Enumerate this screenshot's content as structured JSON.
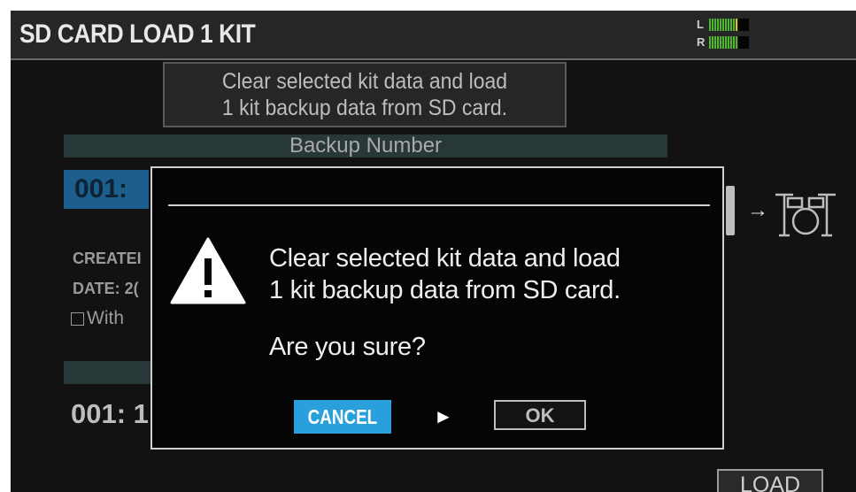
{
  "header": {
    "title": "SD CARD LOAD 1 KIT",
    "meter_left_label": "L",
    "meter_right_label": "R"
  },
  "description": {
    "line1": "Clear selected kit data and load",
    "line2": "1 kit backup data from SD card."
  },
  "backup": {
    "section_label": "Backup Number",
    "selected_number": "001:",
    "created_label": "CREATEI",
    "date_label": "DATE: 2(",
    "with_option_label": "With",
    "kit_number": "001: 1"
  },
  "load_button": {
    "label": "LOAD"
  },
  "dialog": {
    "message_line1": "Clear selected kit data and load",
    "message_line2": "1 kit backup data from SD card.",
    "question": "Are you sure?",
    "cancel_label": "CANCEL",
    "ok_label": "OK"
  },
  "icons": {
    "warning": "warning-triangle-icon",
    "cursor": "play-arrow-icon",
    "drum": "drum-kit-icon",
    "arrow": "arrow-right-icon"
  },
  "colors": {
    "accent": "#29a0dc",
    "selected_number_bg": "#1c5f8c",
    "meter_green": "#4bb82c",
    "meter_yellow": "#e3c21a"
  }
}
